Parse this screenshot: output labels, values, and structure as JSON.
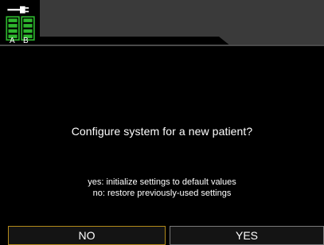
{
  "status_bar": {
    "battery_a_label": "A",
    "battery_b_label": "B",
    "battery_color": "#2db52d",
    "plug_icon": "ac-power-plug-icon"
  },
  "dialog": {
    "question": "Configure system for a new patient?",
    "info_yes": "yes: initialize settings to default values",
    "info_no": "no: restore previously-used settings"
  },
  "buttons": {
    "no_label": "NO",
    "yes_label": "YES",
    "selected": "NO",
    "selected_border_color": "#b28a1a"
  }
}
